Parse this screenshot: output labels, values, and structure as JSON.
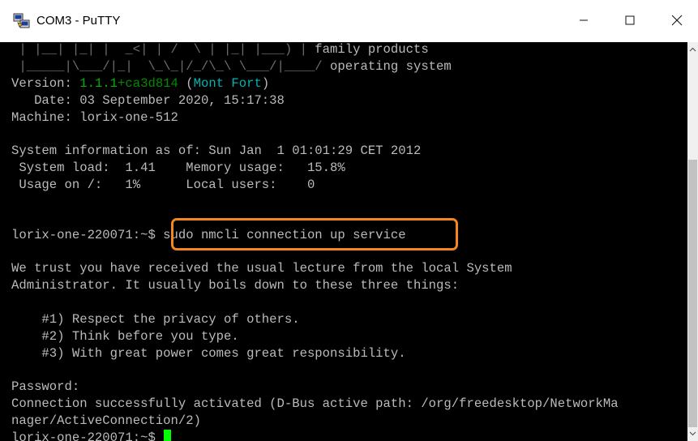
{
  "window": {
    "title": "COM3 - PuTTY",
    "icon": "putty-icon",
    "controls": [
      "minimize-icon",
      "maximize-icon",
      "close-icon"
    ]
  },
  "terminal": {
    "banner_line_1": " | |__| |_| |  _<| | /  \\ | |_| |___) |",
    "banner_line_1_tail": " family products",
    "banner_line_2": " |_____|\\___/|_|  \\_\\_|/_/\\_\\ \\___/|____/",
    "banner_line_2_tail": " operating system",
    "version_label": "Version: ",
    "version_number": "1.1.1",
    "version_hash": "+ca3d814",
    "version_codename_open": " (",
    "version_codename": "Mont Fort",
    "version_codename_close": ")",
    "date_line": "   Date: 03 September 2020, 15:17:38",
    "machine_line": "Machine: lorix-one-512",
    "sysinfo_line": "System information as of: Sun Jan  1 01:01:29 CET 2012",
    "system_load_line": " System load:  1.41    Memory usage:   15.8%",
    "usage_line": " Usage on /:   1%      Local users:    0",
    "prompt": "lorix-one-220071:~$ ",
    "command": "sudo nmcli connection up service",
    "lecture_line_1": "We trust you have received the usual lecture from the local System",
    "lecture_line_2": "Administrator. It usually boils down to these three things:",
    "rule_1": "    #1) Respect the privacy of others.",
    "rule_2": "    #2) Think before you type.",
    "rule_3": "    #3) With great power comes great responsibility.",
    "password_line": "Password:",
    "result_line_1": "Connection successfully activated (D-Bus active path: /org/freedesktop/NetworkMa",
    "result_line_2": "nager/ActiveConnection/2)",
    "final_prompt": "lorix-one-220071:~$ "
  },
  "colors": {
    "highlight": "#f2861f",
    "cursor": "#00ff00",
    "text": "#bbbbbb"
  }
}
